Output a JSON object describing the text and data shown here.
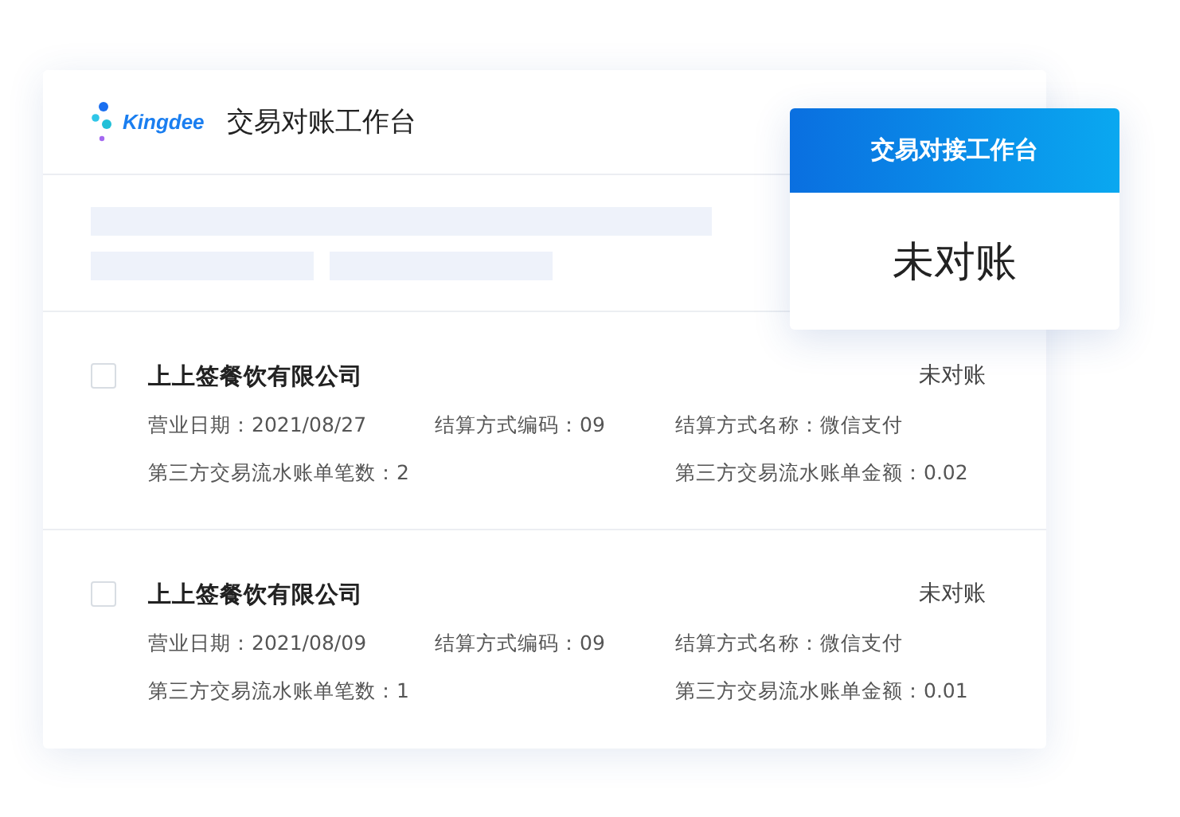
{
  "header": {
    "logo_text": "Kingdee",
    "title": "交易对账工作台"
  },
  "popup": {
    "title": "交易对接工作台",
    "status": "未对账"
  },
  "records": [
    {
      "checked": false,
      "company": "上上签餐饮有限公司",
      "status": "未对账",
      "lines": [
        [
          "营业日期：2021/08/27",
          "结算方式编码：09",
          "结算方式名称：微信支付"
        ],
        [
          "第三方交易流水账单笔数：2",
          "第三方交易流水账单金额：0.02"
        ]
      ]
    },
    {
      "checked": false,
      "company": "上上签餐饮有限公司",
      "status": "未对账",
      "lines": [
        [
          "营业日期：2021/08/09",
          "结算方式编码：09",
          "结算方式名称：微信支付"
        ],
        [
          "第三方交易流水账单笔数：1",
          "第三方交易流水账单金额：0.01"
        ]
      ]
    }
  ]
}
